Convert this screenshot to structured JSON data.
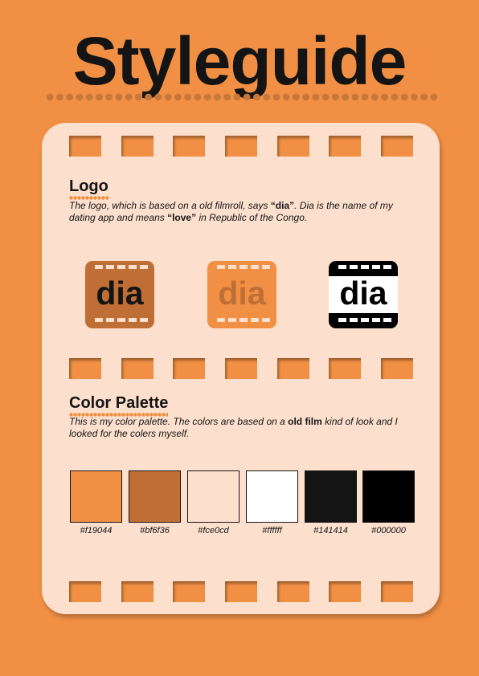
{
  "title": "Styleguide",
  "logo_section": {
    "heading": "Logo",
    "text_1": "The logo, which is based on a old filmroll, says ",
    "bold_1": "“dia”",
    "text_2": ". Dia is the name of my dating app and means ",
    "bold_2": "“love”",
    "text_3": " in Republic of the Congo.",
    "variants": [
      {
        "text": "dia",
        "background": "#bf6f36",
        "text_color": "#141414",
        "hole_color": "#fce0cd"
      },
      {
        "text": "dia",
        "background": "#f19044",
        "text_color": "#bf6f36",
        "hole_color": "#fce0cd"
      },
      {
        "text": "dia",
        "background": "#000000",
        "text_color": "#000000",
        "hole_color": "#ffffff",
        "band_color": "#ffffff"
      }
    ]
  },
  "palette_section": {
    "heading": "Color Palette",
    "text_1": "This is my color palette. The colors are based on a ",
    "bold_1": "old film",
    "text_2": " kind of look and I looked for the colers myself.",
    "colors": [
      {
        "hex": "#f19044",
        "label": "#f19044"
      },
      {
        "hex": "#bf6f36",
        "label": "#bf6f36"
      },
      {
        "hex": "#fce0cd",
        "label": "#fce0cd"
      },
      {
        "hex": "#ffffff",
        "label": "#ffffff"
      },
      {
        "hex": "#141414",
        "label": "#141414"
      },
      {
        "hex": "#000000",
        "label": "#000000"
      }
    ]
  }
}
